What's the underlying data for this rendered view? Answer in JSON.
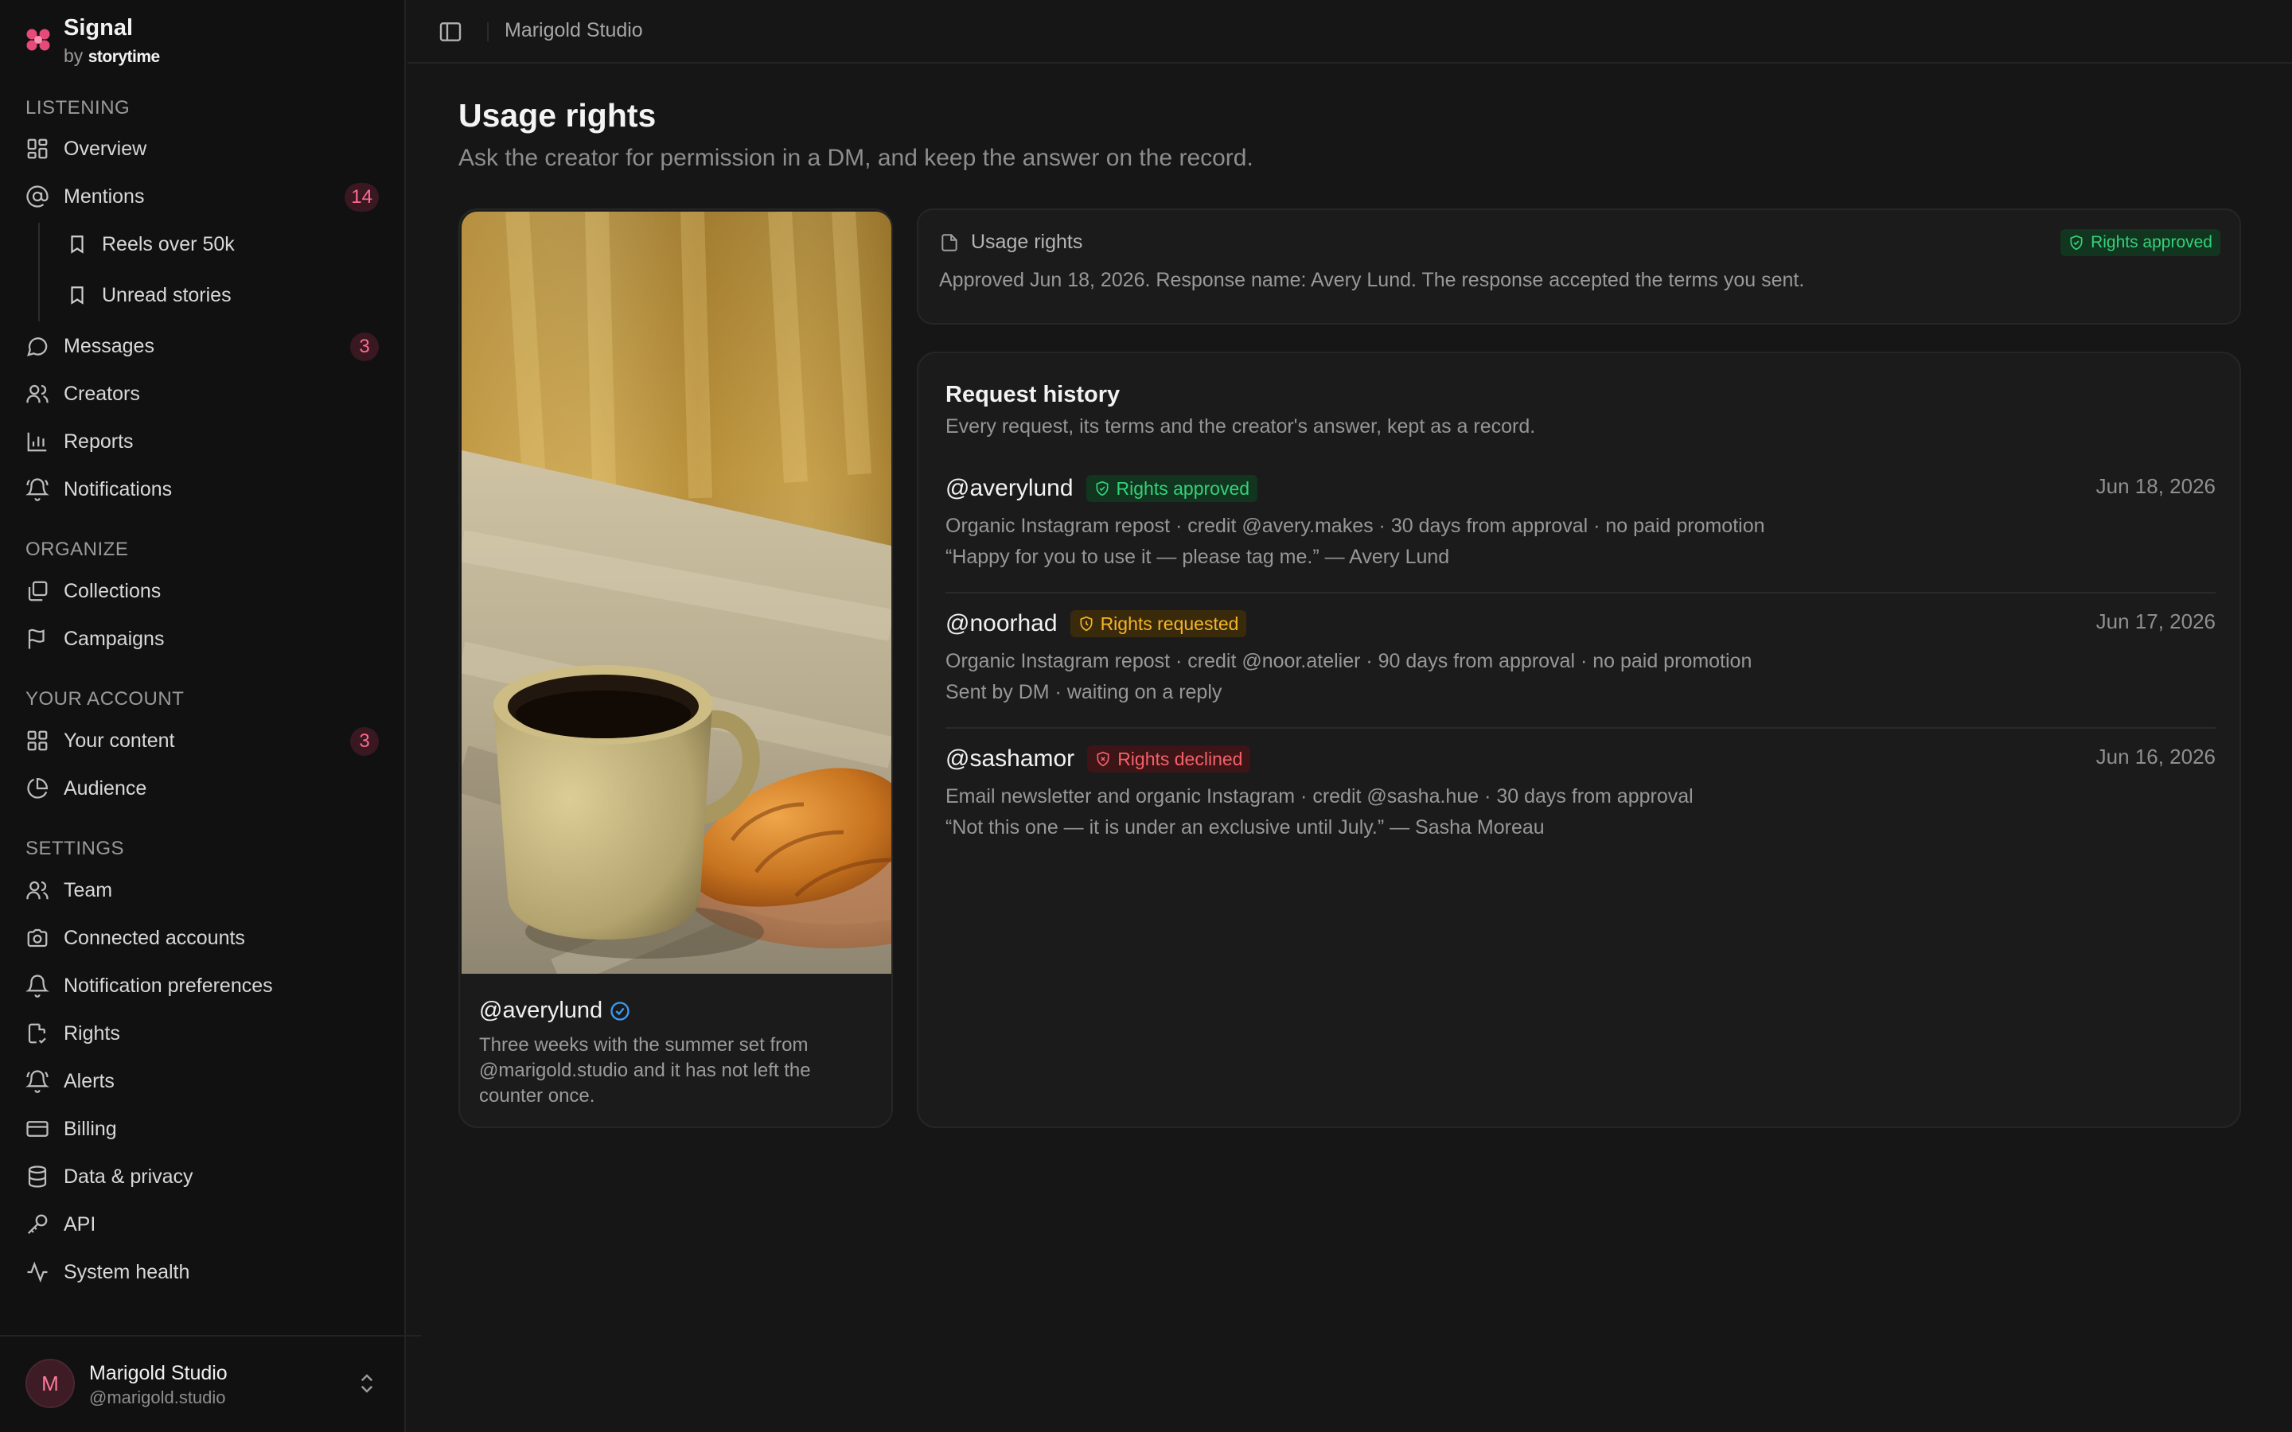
{
  "brand": {
    "title": "Signal",
    "by": "by",
    "maker": "storytime"
  },
  "sidebar": {
    "sections": {
      "listening": "LISTENING",
      "organize": "ORGANIZE",
      "account": "YOUR ACCOUNT",
      "settings": "SETTINGS"
    },
    "listening": {
      "overview": "Overview",
      "mentions": "Mentions",
      "mentions_count": "14",
      "reels": "Reels over 50k",
      "unread": "Unread stories",
      "messages": "Messages",
      "messages_count": "3",
      "creators": "Creators",
      "reports": "Reports",
      "notifications": "Notifications"
    },
    "organize": {
      "collections": "Collections",
      "campaigns": "Campaigns"
    },
    "account": {
      "your_content": "Your content",
      "your_content_count": "3",
      "audience": "Audience"
    },
    "settings": {
      "team": "Team",
      "connected": "Connected accounts",
      "notif_prefs": "Notification preferences",
      "rights": "Rights",
      "alerts": "Alerts",
      "billing": "Billing",
      "privacy": "Data & privacy",
      "api": "API",
      "health": "System health"
    }
  },
  "user": {
    "initial": "M",
    "name": "Marigold Studio",
    "handle": "@marigold.studio"
  },
  "topbar": {
    "breadcrumb": "Marigold Studio"
  },
  "page": {
    "title": "Usage rights",
    "subtitle": "Ask the creator for permission in a DM, and keep the answer on the record."
  },
  "post": {
    "handle": "@averylund",
    "caption": "Three weeks with the summer set from @marigold.studio and it has not left the counter once."
  },
  "rights": {
    "title": "Usage rights",
    "status": "Rights approved",
    "body": "Approved Jun 18, 2026. Response name: Avery Lund. The response accepted the terms you sent."
  },
  "history": {
    "title": "Request history",
    "subtitle": "Every request, its terms and the creator's answer, kept as a record.",
    "requests": [
      {
        "handle": "@averylund",
        "status": "Rights approved",
        "date": "Jun 18, 2026",
        "terms": "Organic Instagram repost · credit @avery.makes · 30 days from approval · no paid promotion",
        "note": "“Happy for you to use it — please tag me.” — Avery Lund"
      },
      {
        "handle": "@noorhad",
        "status": "Rights requested",
        "date": "Jun 17, 2026",
        "terms": "Organic Instagram repost · credit @noor.atelier · 90 days from approval · no paid promotion",
        "note": "Sent by DM · waiting on a reply"
      },
      {
        "handle": "@sashamor",
        "status": "Rights declined",
        "date": "Jun 16, 2026",
        "terms": "Email newsletter and organic Instagram · credit @sasha.hue · 30 days from approval",
        "note": "“Not this one — it is under an exclusive until July.” — Sasha Moreau"
      }
    ]
  },
  "colors": {
    "accent": "#ff6b8e",
    "approved": "#34d17a",
    "requested": "#f5b527",
    "declined": "#f2626a",
    "verified": "#3b9bf5"
  }
}
